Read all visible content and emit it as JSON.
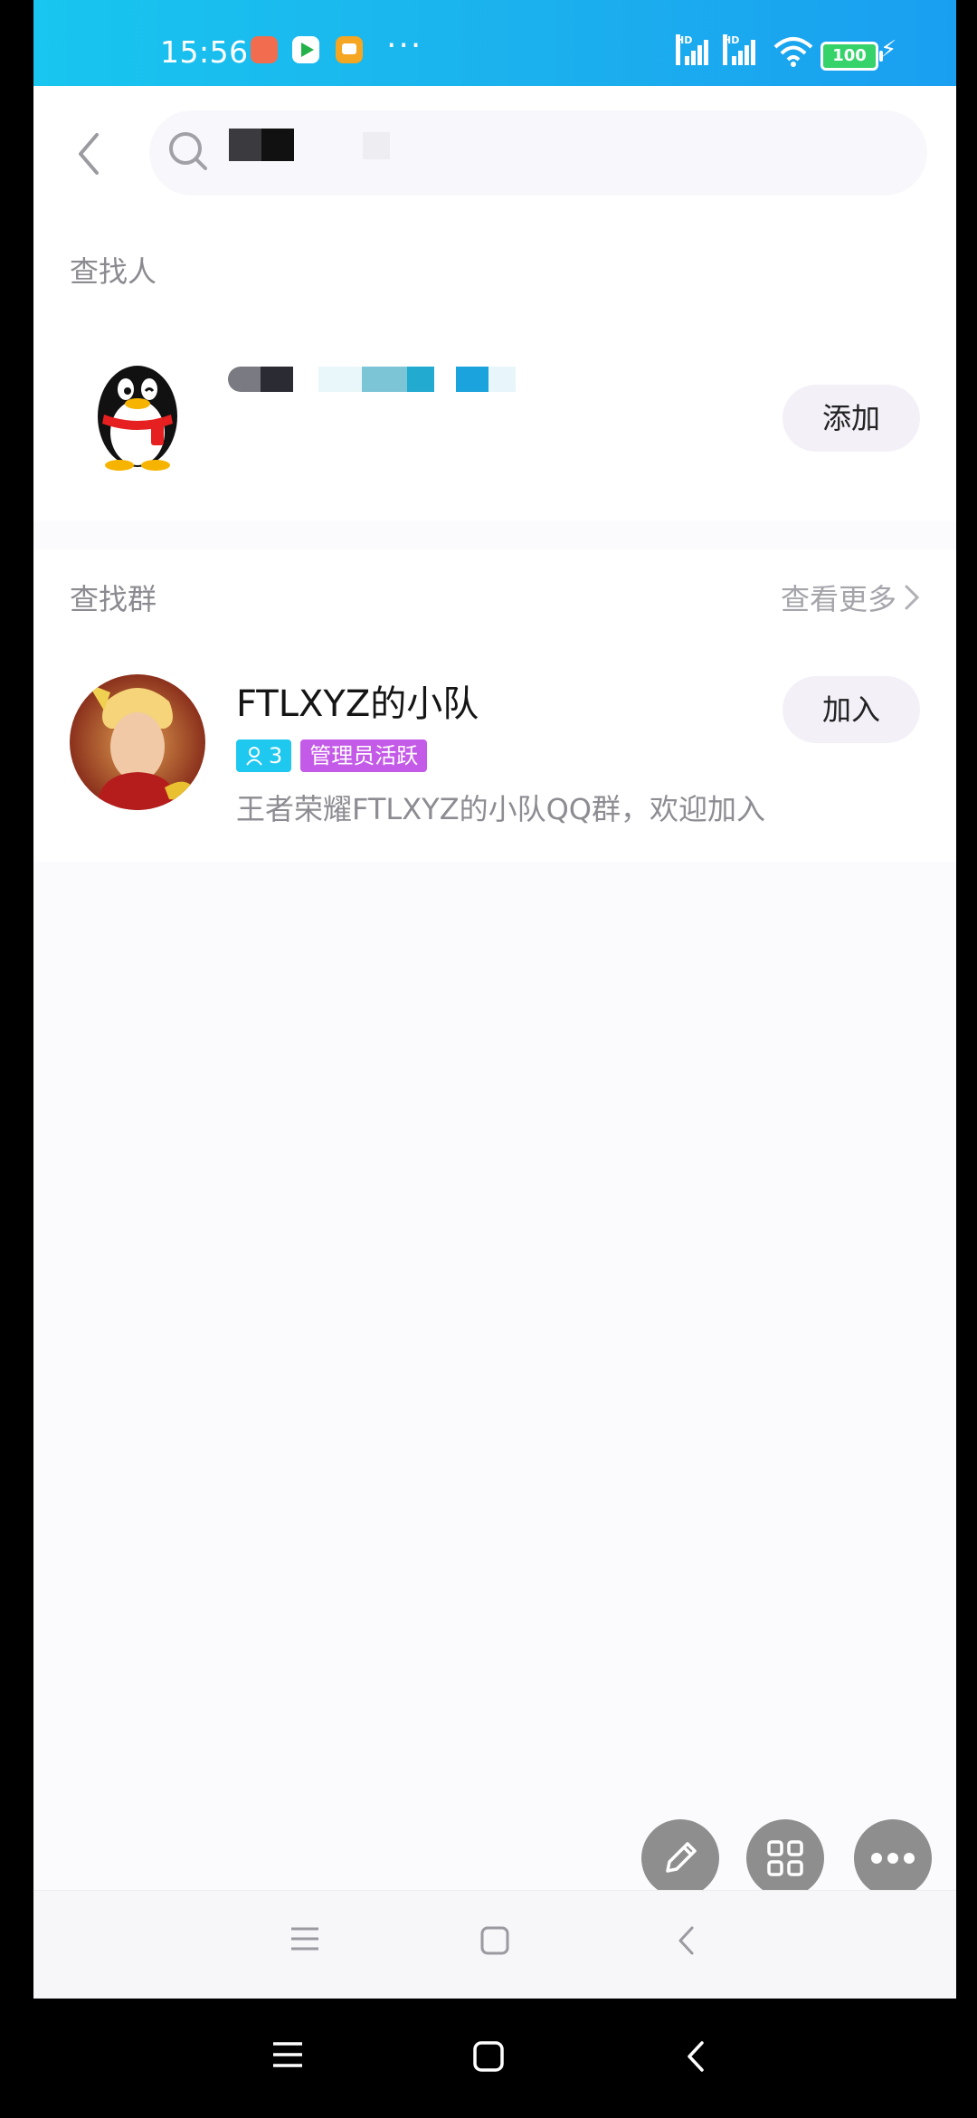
{
  "status_bar": {
    "time": "15:56",
    "more_indicator": "···",
    "hd_label": "HD",
    "battery": "100"
  },
  "search": {
    "icon": "search-icon"
  },
  "people_section": {
    "title": "查找人",
    "add_button": "添加"
  },
  "group_section": {
    "title": "查找群",
    "view_more": "查看更多",
    "group": {
      "name": "FTLXYZ的小队",
      "member_count": "3",
      "badge": "管理员活跃",
      "description": "王者荣耀FTLXYZ的小队QQ群，欢迎加入",
      "join_button": "加入"
    }
  },
  "fabs": [
    "pencil-icon",
    "grid-icon",
    "more-icon"
  ],
  "colors": {
    "status_bar": "#1bb0ee",
    "count_tag": "#1ec8ef",
    "admin_tag": "#c45ae8",
    "button_bg": "#f3f0f8"
  }
}
